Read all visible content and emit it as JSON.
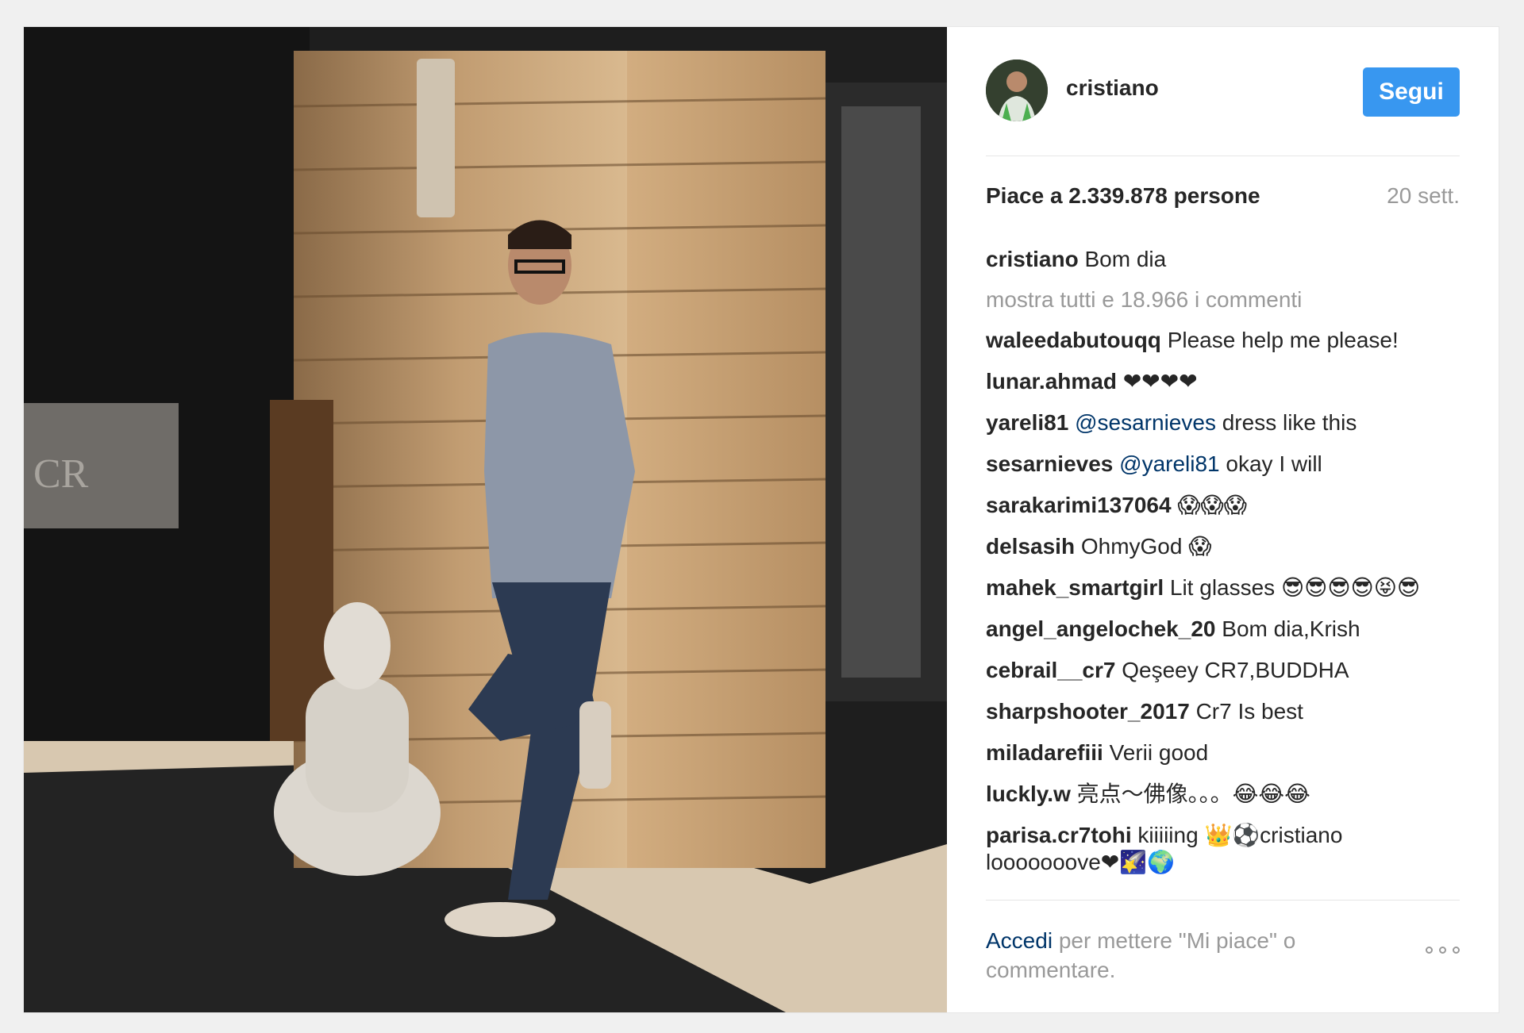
{
  "post": {
    "username": "cristiano",
    "follow_label": "Segui",
    "likes_text": "Piace a 2.339.878 persone",
    "time_text": "20 sett.",
    "caption_user": "cristiano",
    "caption_text": "Bom dia",
    "show_all_comments": "mostra tutti e 18.966 i commenti",
    "comments": [
      {
        "user": "waleedabutouqq",
        "text": "Please help me please!"
      },
      {
        "user": "lunar.ahmad",
        "text": "❤❤❤❤"
      },
      {
        "user": "yareli81",
        "mention": "@sesarnieves",
        "text": "dress like this"
      },
      {
        "user": "sesarnieves",
        "mention": "@yareli81",
        "text": "okay I will"
      },
      {
        "user": "sarakarimi137064",
        "text": "😱😱😱"
      },
      {
        "user": "delsasih",
        "text": "OhmyGod 😱"
      },
      {
        "user": "mahek_smartgirl",
        "text": "Lit glasses 😎😎😎😎😝😎"
      },
      {
        "user": "angel_angelochek_20",
        "text": "Bom dia,Krish"
      },
      {
        "user": "cebrail__cr7",
        "text": "Qeşeey CR7,BUDDHA"
      },
      {
        "user": "sharpshooter_2017",
        "text": "Cr7 Is best"
      },
      {
        "user": "miladarefiii",
        "text": "Verii good"
      },
      {
        "user": "luckly.w",
        "text": "亮点～佛像。。。😂😂😂"
      },
      {
        "user": "parisa.cr7tohi",
        "text": "kiiiiing 👑⚽cristiano looooooove❤🌠🌍"
      }
    ],
    "login_link": "Accedi",
    "login_text": "per mettere \"Mi piace\" o commentare.",
    "photo_sign_text": "CR"
  },
  "colors": {
    "follow_button": "#3897f0",
    "link": "#003569",
    "muted": "#999999"
  }
}
